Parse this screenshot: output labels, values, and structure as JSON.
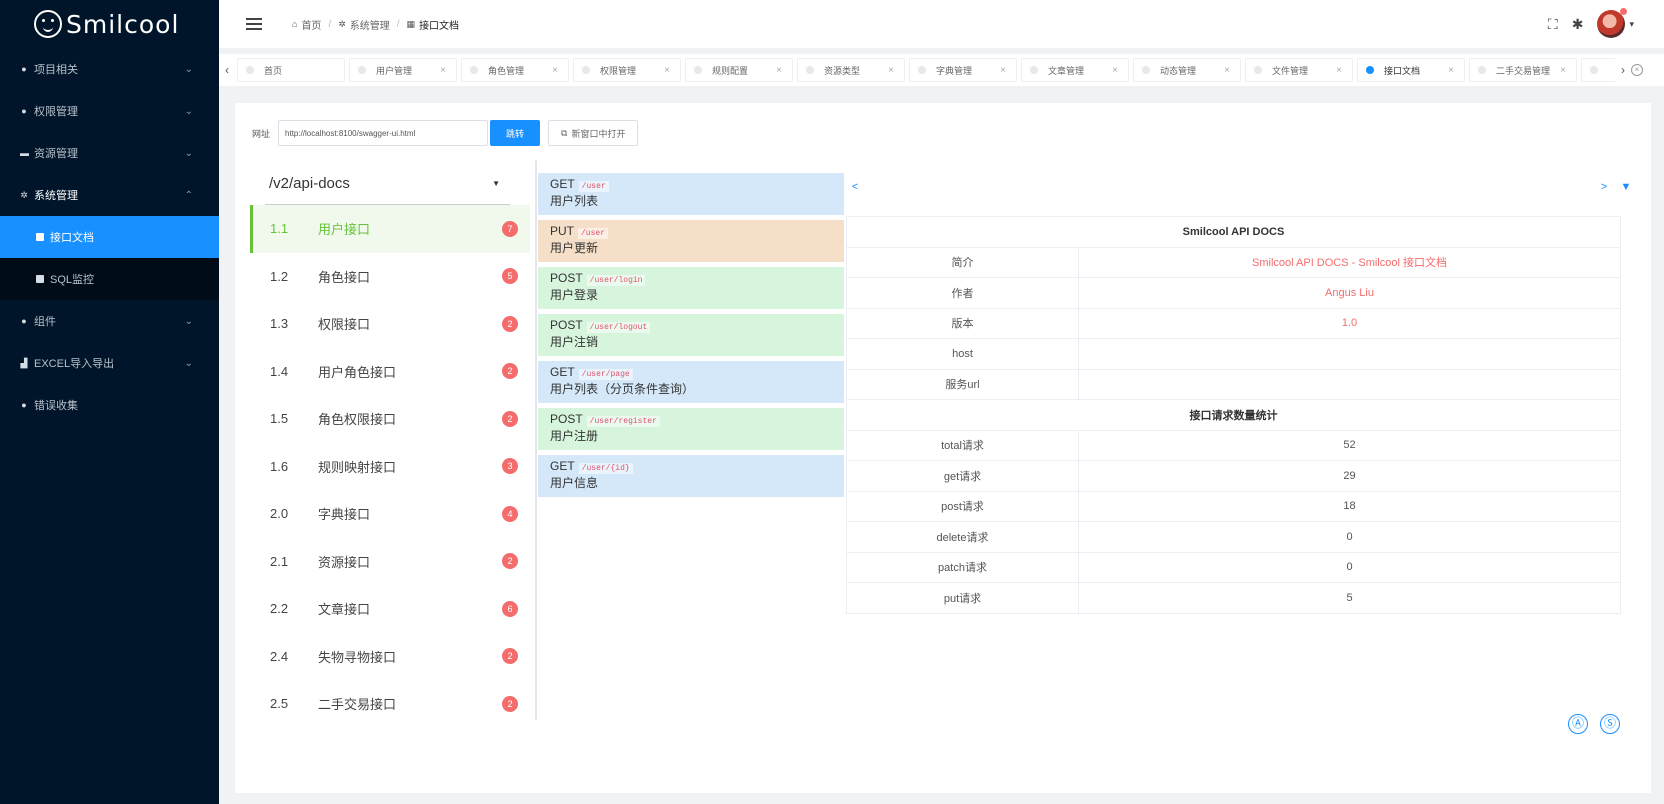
{
  "app": {
    "brand": "Smilcool"
  },
  "sidebar": {
    "items": [
      {
        "label": "项目相关",
        "icon": "dot-icon",
        "expanded": false
      },
      {
        "label": "权限管理",
        "icon": "dot-icon",
        "expanded": false
      },
      {
        "label": "资源管理",
        "icon": "folder-icon",
        "expanded": false
      },
      {
        "label": "系统管理",
        "icon": "gear-icon",
        "expanded": true,
        "children": [
          {
            "label": "接口文档",
            "active": true
          },
          {
            "label": "SQL监控",
            "active": false
          }
        ]
      },
      {
        "label": "组件",
        "icon": "dot-icon",
        "expanded": false
      },
      {
        "label": "EXCEL导入导出",
        "icon": "chart-icon",
        "expanded": false
      },
      {
        "label": "错误收集",
        "icon": "dot-icon",
        "expanded": null
      }
    ]
  },
  "header": {
    "breadcrumb": [
      "首页",
      "系统管理",
      "接口文档"
    ]
  },
  "tabs": [
    {
      "label": "首页",
      "active": false
    },
    {
      "label": "用户管理",
      "active": false
    },
    {
      "label": "角色管理",
      "active": false
    },
    {
      "label": "权限管理",
      "active": false
    },
    {
      "label": "规则配置",
      "active": false
    },
    {
      "label": "资源类型",
      "active": false
    },
    {
      "label": "字典管理",
      "active": false
    },
    {
      "label": "文章管理",
      "active": false
    },
    {
      "label": "动态管理",
      "active": false
    },
    {
      "label": "文件管理",
      "active": false
    },
    {
      "label": "接口文档",
      "active": true
    },
    {
      "label": "二手交易管理",
      "active": false
    },
    {
      "label": "",
      "active": false
    }
  ],
  "url_bar": {
    "label": "网址",
    "value": "http://localhost:8100/swagger-ui.html",
    "goto_label": "跳转",
    "new_window_label": "新窗口中打开"
  },
  "api_list": {
    "selected_spec": "/v2/api-docs",
    "groups": [
      {
        "num": "1.1",
        "name": "用户接口",
        "count": "7",
        "active": true
      },
      {
        "num": "1.2",
        "name": "角色接口",
        "count": "5",
        "active": false
      },
      {
        "num": "1.3",
        "name": "权限接口",
        "count": "2",
        "active": false
      },
      {
        "num": "1.4",
        "name": "用户角色接口",
        "count": "2",
        "active": false
      },
      {
        "num": "1.5",
        "name": "角色权限接口",
        "count": "2",
        "active": false
      },
      {
        "num": "1.6",
        "name": "规则映射接口",
        "count": "3",
        "active": false
      },
      {
        "num": "2.0",
        "name": "字典接口",
        "count": "4",
        "active": false
      },
      {
        "num": "2.1",
        "name": "资源接口",
        "count": "2",
        "active": false
      },
      {
        "num": "2.2",
        "name": "文章接口",
        "count": "6",
        "active": false
      },
      {
        "num": "2.4",
        "name": "失物寻物接口",
        "count": "2",
        "active": false
      },
      {
        "num": "2.5",
        "name": "二手交易接口",
        "count": "2",
        "active": false
      }
    ]
  },
  "endpoints": [
    {
      "method": "GET",
      "path": "/user",
      "desc": "用户列表",
      "type": "get"
    },
    {
      "method": "PUT",
      "path": "/user",
      "desc": "用户更新",
      "type": "put"
    },
    {
      "method": "POST",
      "path": "/user/login",
      "desc": "用户登录",
      "type": "post"
    },
    {
      "method": "POST",
      "path": "/user/logout",
      "desc": "用户注销",
      "type": "post"
    },
    {
      "method": "GET",
      "path": "/user/page",
      "desc": "用户列表（分页条件查询）",
      "type": "get"
    },
    {
      "method": "POST",
      "path": "/user/register",
      "desc": "用户注册",
      "type": "post"
    },
    {
      "method": "GET",
      "path": "/user/{id}",
      "desc": "用户信息",
      "type": "get"
    }
  ],
  "doc": {
    "title": "Smilcool API DOCS",
    "info": [
      {
        "key": "简介",
        "value": "Smilcool API DOCS - Smilcool 接口文档",
        "highlight": true
      },
      {
        "key": "作者",
        "value": "Angus Liu",
        "highlight": true
      },
      {
        "key": "版本",
        "value": "1.0",
        "highlight": true
      },
      {
        "key": "host",
        "value": "",
        "highlight": false
      },
      {
        "key": "服务url",
        "value": "",
        "highlight": false
      }
    ],
    "stats_title": "接口请求数量统计",
    "stats": [
      {
        "key": "total请求",
        "value": "52"
      },
      {
        "key": "get请求",
        "value": "29"
      },
      {
        "key": "post请求",
        "value": "18"
      },
      {
        "key": "delete请求",
        "value": "0"
      },
      {
        "key": "patch请求",
        "value": "0"
      },
      {
        "key": "put请求",
        "value": "5"
      }
    ]
  },
  "nav": {
    "prev": "<",
    "next": ">",
    "more": "▼"
  },
  "footer_icons": [
    "Ⓐ",
    "Ⓢ"
  ],
  "colors": {
    "sidebar_bg": "#001529",
    "accent": "#1890ff",
    "badge": "#f56c6c",
    "active_group": "#67c23a"
  }
}
